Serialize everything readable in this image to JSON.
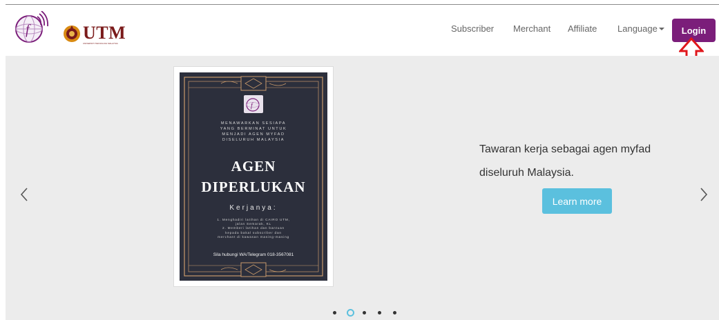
{
  "nav": {
    "subscriber": "Subscriber",
    "merchant": "Merchant",
    "affiliate": "Affiliate",
    "language": "Language",
    "login": "Login"
  },
  "brand": {
    "utm_text": "UTM",
    "utm_sub": "UNIVERSITI TEKNOLOGI MALAYSIA",
    "fad_text": "f"
  },
  "slide": {
    "poster": {
      "offer_lines": [
        "MENAWARKAN SESIAPA",
        "YANG BERMINAT UNTUK",
        "MENJADI AGEN MYFAD",
        "DISELURUH MALAYSIA"
      ],
      "title_line1": "AGEN",
      "title_line2": "DIPERLUKAN",
      "kerjanya": "Kerjanya:",
      "tasks": [
        "1. Menghadiri latihan di CAIRO UTM,",
        "jalan Semarak, KL",
        "2. Memberi latihan dan bantuan",
        "kepada bakal subscriber dan",
        "merchant di kawasan masing-masing"
      ],
      "contact": "Sila hubungi WA/Telegram 018-3567081"
    },
    "caption_line1": "Tawaran kerja sebagai agen myfad",
    "caption_line2": "diseluruh Malaysia.",
    "learn_more": "Learn more"
  },
  "carousel": {
    "indicator_count": 5,
    "active_index": 1,
    "prev_icon": "chevron-left-icon",
    "next_icon": "chevron-right-icon"
  },
  "colors": {
    "login_bg": "#7b1e7a",
    "learn_more_bg": "#5bc0de",
    "arrow_annotation": "#e0161b",
    "poster_bg": "#2c2f3c",
    "poster_gold": "#c99a6b"
  }
}
